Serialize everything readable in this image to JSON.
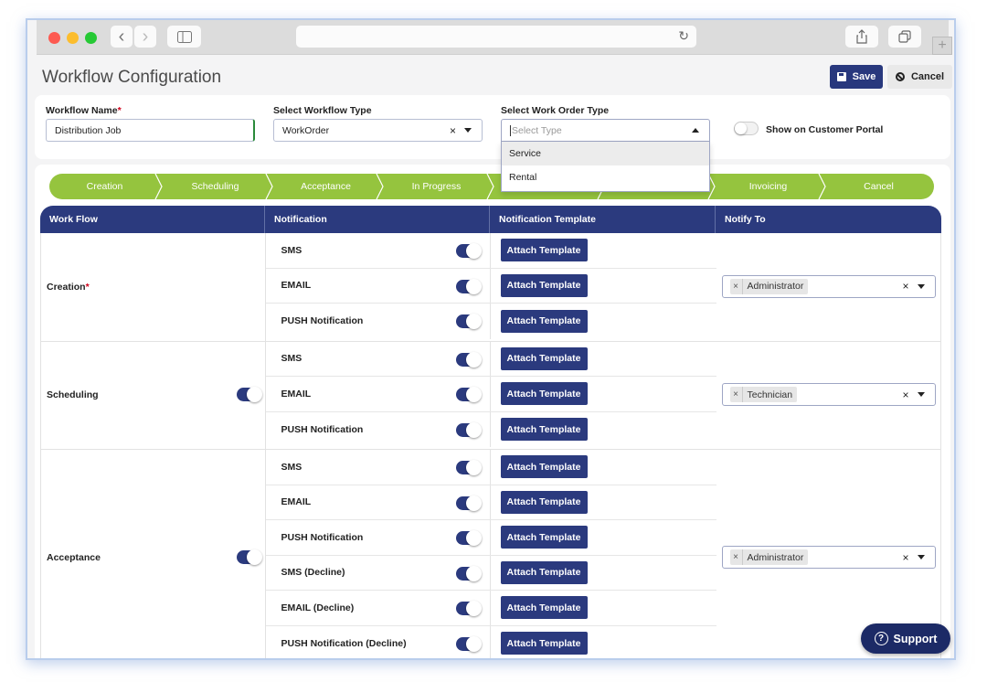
{
  "browser": {
    "nav_back": "‹",
    "nav_forward": "›",
    "sidebar_icon": "sidebar-icon",
    "reload_icon": "↻",
    "share_icon": "share-icon",
    "tabs_icon": "tabs-icon",
    "new_tab": "+"
  },
  "header": {
    "title": "Workflow Configuration",
    "save_label": "Save",
    "cancel_label": "Cancel"
  },
  "form": {
    "workflow_name_label": "Workflow Name",
    "required_mark": "*",
    "workflow_name_value": "Distribution Job",
    "workflow_type_label": "Select Workflow Type",
    "workflow_type_value": "WorkOrder",
    "work_order_type_label": "Select Work Order Type",
    "work_order_type_placeholder": "Select Type",
    "work_order_type_options": [
      "Service",
      "Rental"
    ],
    "portal_label": "Show on Customer Portal",
    "portal_enabled": false,
    "clear_glyph": "×"
  },
  "steps": [
    "Creation",
    "Scheduling",
    "Acceptance",
    "In Progress",
    "",
    "",
    "Invoicing",
    "Cancel"
  ],
  "table": {
    "headers": [
      "Work Flow",
      "Notification",
      "Notification Template",
      "Notify To"
    ],
    "attach_label": "Attach Template",
    "groups": [
      {
        "name": "Creation",
        "required": true,
        "has_toggle": false,
        "notify_to": "Administrator",
        "notifications": [
          {
            "label": "SMS",
            "enabled": true
          },
          {
            "label": "EMAIL",
            "enabled": true
          },
          {
            "label": "PUSH Notification",
            "enabled": true
          }
        ]
      },
      {
        "name": "Scheduling",
        "required": false,
        "has_toggle": true,
        "enabled": true,
        "notify_to": "Technician",
        "notifications": [
          {
            "label": "SMS",
            "enabled": true
          },
          {
            "label": "EMAIL",
            "enabled": true
          },
          {
            "label": "PUSH Notification",
            "enabled": true
          }
        ]
      },
      {
        "name": "Acceptance",
        "required": false,
        "has_toggle": true,
        "enabled": true,
        "notify_to": "Administrator",
        "notifications": [
          {
            "label": "SMS",
            "enabled": true
          },
          {
            "label": "EMAIL",
            "enabled": true
          },
          {
            "label": "PUSH Notification",
            "enabled": true
          },
          {
            "label": "SMS (Decline)",
            "enabled": true
          },
          {
            "label": "EMAIL (Decline)",
            "enabled": true
          },
          {
            "label": "PUSH Notification (Decline)",
            "enabled": true
          }
        ]
      }
    ]
  },
  "support": {
    "label": "Support",
    "icon": "?"
  },
  "colors": {
    "primary": "#2b3a7e",
    "step_green": "#95c43e",
    "support_bg": "#1c2a66",
    "required": "#d0021b"
  }
}
